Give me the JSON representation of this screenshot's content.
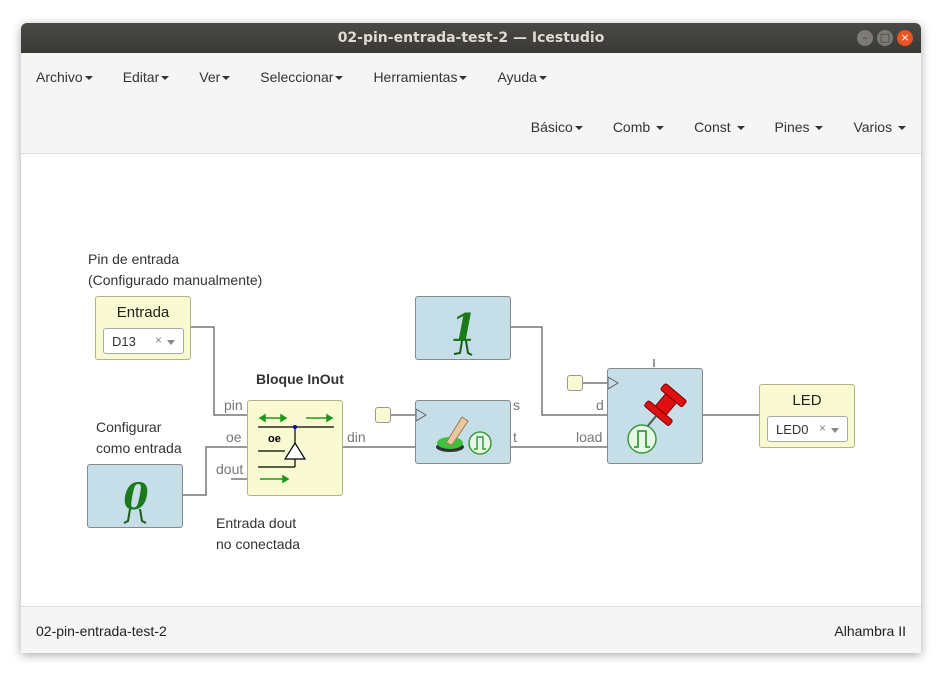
{
  "window": {
    "title": "02-pin-entrada-test-2 — Icestudio",
    "controls": {
      "minimize": "–",
      "maximize": "□",
      "close": "×"
    }
  },
  "menu": {
    "items": [
      "Archivo",
      "Editar",
      "Ver",
      "Seleccionar",
      "Herramientas",
      "Ayuda"
    ]
  },
  "categories": {
    "items": [
      "Básico",
      "Comb",
      "Const",
      "Pines",
      "Varios"
    ]
  },
  "canvas": {
    "pin_comment": [
      "Pin de entrada",
      "(Configurado manualmente)"
    ],
    "input_block": {
      "name": "Entrada",
      "value": "D13",
      "clear": "×"
    },
    "config_comment": [
      "Configurar",
      "como entrada"
    ],
    "inout_title": "Bloque InOut",
    "inout_ports": {
      "pin": "pin",
      "oe": "oe",
      "dout": "dout",
      "din": "din",
      "oe_inner": "oe"
    },
    "dout_comment": [
      "Entrada dout",
      "no conectada"
    ],
    "const_one": "1",
    "const_zero": "0",
    "toggle_ports": {
      "s": "s",
      "t": "t"
    },
    "dff_ports": {
      "d": "d",
      "load": "load"
    },
    "output_block": {
      "name": "LED",
      "value": "LED0",
      "clear": "×"
    }
  },
  "status": {
    "left": "02-pin-entrada-test-2",
    "right": "Alhambra II"
  },
  "colors": {
    "titlebar": "#3c3b37",
    "close_button": "#e95420",
    "io_block": "#fafad2",
    "logic_block": "#c6dee8",
    "const_green": "#1a7a1a",
    "pin_red": "#e01010"
  }
}
